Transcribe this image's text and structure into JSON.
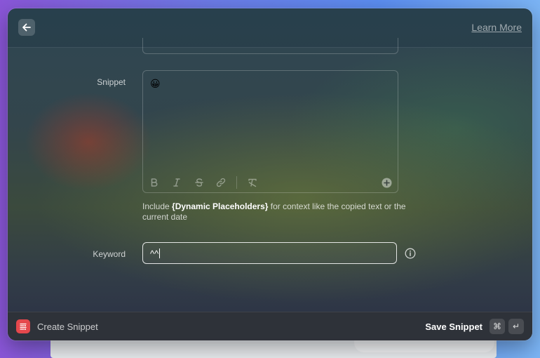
{
  "header": {
    "learn_more": "Learn More"
  },
  "form": {
    "snippet_label": "Snippet",
    "snippet_value": "😀",
    "toolbar": [
      "bold-icon",
      "italic-icon",
      "strikethrough-icon",
      "link-icon",
      "clear-format-icon",
      "add-placeholder-icon"
    ],
    "hint_prefix": "Include ",
    "hint_highlight": "{Dynamic Placeholders}",
    "hint_suffix": " for context like the copied text or the current date",
    "keyword_label": "Keyword",
    "keyword_value": "^^"
  },
  "footer": {
    "title": "Create Snippet",
    "save_label": "Save Snippet",
    "shortcut_keys": [
      "⌘",
      "↵"
    ]
  },
  "colors": {
    "accent_red": "#e5484d",
    "text": "#ffffff"
  }
}
